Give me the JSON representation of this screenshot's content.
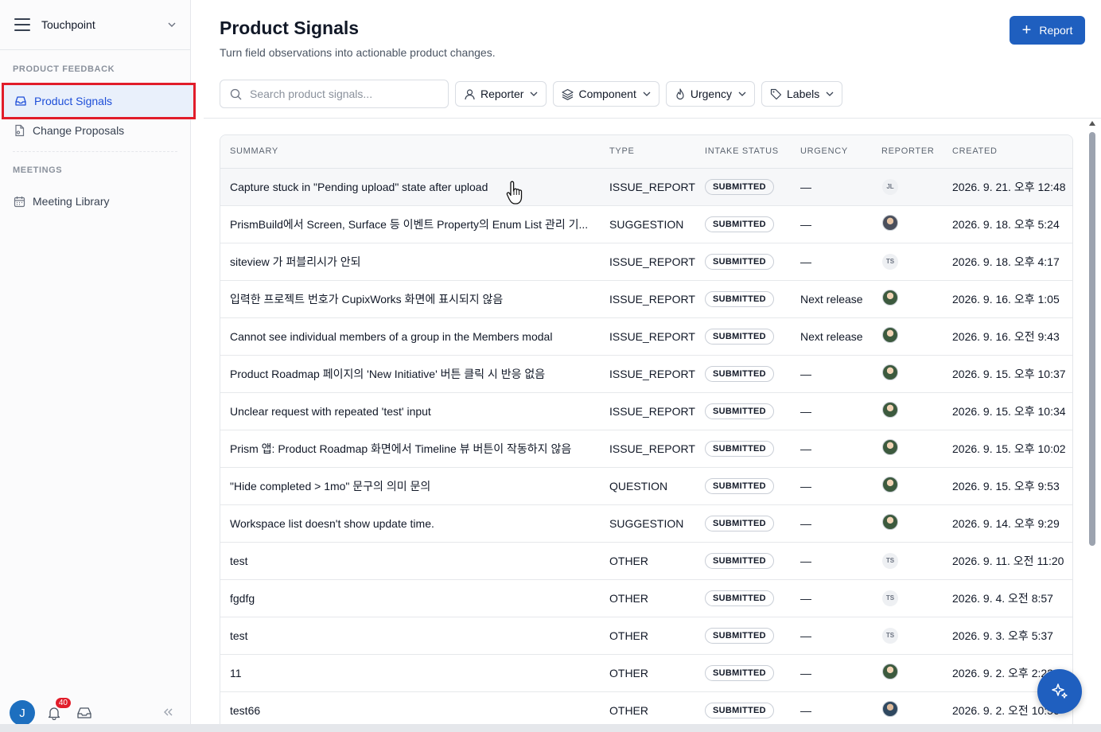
{
  "workspace": {
    "name": "Touchpoint"
  },
  "sidebar": {
    "sections": [
      {
        "label": "PRODUCT FEEDBACK",
        "items": [
          {
            "label": "Product Signals",
            "icon": "inbox-icon",
            "active": true
          },
          {
            "label": "Change Proposals",
            "icon": "document-icon",
            "active": false
          }
        ]
      },
      {
        "label": "MEETINGS",
        "items": [
          {
            "label": "Meeting Library",
            "icon": "calendar-icon",
            "active": false
          }
        ]
      }
    ],
    "footer": {
      "avatar_initial": "J",
      "notification_count": "40"
    }
  },
  "header": {
    "title": "Product Signals",
    "subtitle": "Turn field observations into actionable product changes.",
    "report_button": "Report"
  },
  "filters": {
    "search_placeholder": "Search product signals...",
    "reporter": "Reporter",
    "component": "Component",
    "urgency": "Urgency",
    "labels": "Labels"
  },
  "table": {
    "columns": [
      "SUMMARY",
      "TYPE",
      "INTAKE STATUS",
      "URGENCY",
      "REPORTER",
      "CREATED"
    ],
    "rows": [
      {
        "summary": "Capture stuck in \"Pending upload\" state after upload",
        "type": "ISSUE_REPORT",
        "status": "SUBMITTED",
        "urgency": "—",
        "reporter": "JL",
        "reporter_photo": false,
        "created": "2026. 9. 21. 오후 12:48"
      },
      {
        "summary": "PrismBuild에서 Screen, Surface 등 이벤트 Property의 Enum List 관리 기...",
        "type": "SUGGESTION",
        "status": "SUBMITTED",
        "urgency": "—",
        "reporter": "",
        "reporter_photo": true,
        "created": "2026. 9. 18. 오후 5:24"
      },
      {
        "summary": "siteview 가 퍼블리시가 안되",
        "type": "ISSUE_REPORT",
        "status": "SUBMITTED",
        "urgency": "—",
        "reporter": "TS",
        "reporter_photo": false,
        "created": "2026. 9. 18. 오후 4:17"
      },
      {
        "summary": "입력한 프로젝트 번호가 CupixWorks 화면에 표시되지 않음",
        "type": "ISSUE_REPORT",
        "status": "SUBMITTED",
        "urgency": "Next release",
        "reporter": "",
        "reporter_photo": true,
        "created": "2026. 9. 16. 오후 1:05"
      },
      {
        "summary": "Cannot see individual members of a group in the Members modal",
        "type": "ISSUE_REPORT",
        "status": "SUBMITTED",
        "urgency": "Next release",
        "reporter": "",
        "reporter_photo": true,
        "created": "2026. 9. 16. 오전 9:43"
      },
      {
        "summary": "Product Roadmap 페이지의 'New Initiative' 버튼 클릭 시 반응 없음",
        "type": "ISSUE_REPORT",
        "status": "SUBMITTED",
        "urgency": "—",
        "reporter": "",
        "reporter_photo": true,
        "created": "2026. 9. 15. 오후 10:37"
      },
      {
        "summary": "Unclear request with repeated 'test' input",
        "type": "ISSUE_REPORT",
        "status": "SUBMITTED",
        "urgency": "—",
        "reporter": "",
        "reporter_photo": true,
        "created": "2026. 9. 15. 오후 10:34"
      },
      {
        "summary": "Prism 앱: Product Roadmap 화면에서 Timeline 뷰 버튼이 작동하지 않음",
        "type": "ISSUE_REPORT",
        "status": "SUBMITTED",
        "urgency": "—",
        "reporter": "",
        "reporter_photo": true,
        "created": "2026. 9. 15. 오후 10:02"
      },
      {
        "summary": "\"Hide completed > 1mo\" 문구의 의미 문의",
        "type": "QUESTION",
        "status": "SUBMITTED",
        "urgency": "—",
        "reporter": "",
        "reporter_photo": true,
        "created": "2026. 9. 15. 오후 9:53"
      },
      {
        "summary": "Workspace list doesn't show update time.",
        "type": "SUGGESTION",
        "status": "SUBMITTED",
        "urgency": "—",
        "reporter": "",
        "reporter_photo": true,
        "created": "2026. 9. 14. 오후 9:29"
      },
      {
        "summary": "test",
        "type": "OTHER",
        "status": "SUBMITTED",
        "urgency": "—",
        "reporter": "TS",
        "reporter_photo": false,
        "created": "2026. 9. 11. 오전 11:20"
      },
      {
        "summary": "fgdfg",
        "type": "OTHER",
        "status": "SUBMITTED",
        "urgency": "—",
        "reporter": "TS",
        "reporter_photo": false,
        "created": "2026. 9. 4. 오전 8:57"
      },
      {
        "summary": "test",
        "type": "OTHER",
        "status": "SUBMITTED",
        "urgency": "—",
        "reporter": "TS",
        "reporter_photo": false,
        "created": "2026. 9. 3. 오후 5:37"
      },
      {
        "summary": "11",
        "type": "OTHER",
        "status": "SUBMITTED",
        "urgency": "—",
        "reporter": "",
        "reporter_photo": true,
        "created": "2026. 9. 2. 오후 2:22"
      },
      {
        "summary": "test66",
        "type": "OTHER",
        "status": "SUBMITTED",
        "urgency": "—",
        "reporter": "",
        "reporter_photo": true,
        "created": "2026. 9. 2. 오전 10:56"
      }
    ]
  },
  "colors": {
    "accent": "#1f5fbf",
    "active_bg": "#e9f0fb",
    "highlight_border": "#e11d2a"
  }
}
